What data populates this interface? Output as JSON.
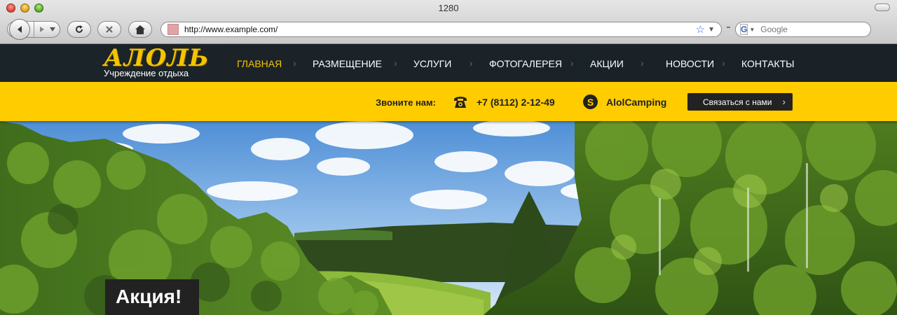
{
  "browser": {
    "window_title": "1280",
    "url": "http://www.example.com/",
    "search_placeholder": "Google",
    "search_engine_letter": "G"
  },
  "site": {
    "logo_title": "АЛОЛЬ",
    "logo_subtitle": "Учреждение отдыха",
    "menu": [
      {
        "label": "Главная",
        "active": true
      },
      {
        "label": "Размещение"
      },
      {
        "label": "Услуги"
      },
      {
        "label": "Фотогалерея"
      },
      {
        "label": "Акции"
      },
      {
        "label": "Новости"
      },
      {
        "label": "Контакты"
      }
    ],
    "contact": {
      "call_label": "Звоните нам:",
      "phone": "+7 (8112) 2-12-49",
      "skype_letter": "S",
      "skype": "AlolCamping",
      "button_label": "Связаться с нами"
    },
    "promo_label": "Акция!"
  },
  "colors": {
    "accent": "#ffcc00",
    "nav_bg": "#1a2228",
    "dark": "#222222"
  }
}
